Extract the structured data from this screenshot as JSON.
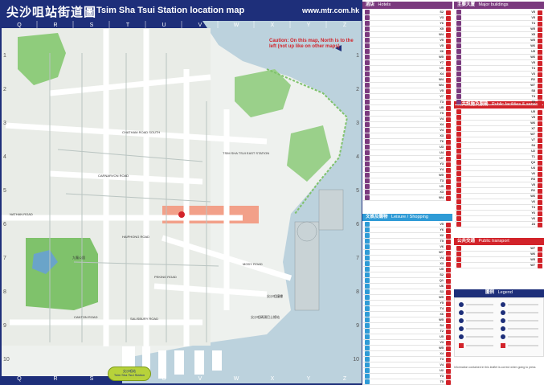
{
  "header": {
    "title_zh": "尖沙咀站街道圖",
    "title_en": "Tsim Sha Tsui Station location map",
    "url": "www.mtr.com.hk"
  },
  "map": {
    "grid_columns": [
      "Q",
      "R",
      "S",
      "T",
      "U",
      "V",
      "W",
      "X",
      "Y",
      "Z"
    ],
    "grid_rows": [
      "1",
      "2",
      "3",
      "4",
      "5",
      "6",
      "7",
      "8",
      "9",
      "10"
    ],
    "caution": "Caution: On this map, North is to the left (not up like on other maps)",
    "colors": {
      "water": "#bcd2dd",
      "land": "#eef1ee",
      "park": "#7fc26b",
      "station": "#f2a089",
      "road": "#ffffff"
    },
    "labels": {
      "chatham_road": "CHATHAM ROAD SOUTH",
      "nathan_road": "NATHAN ROAD",
      "salisbury_road": "SALISBURY ROAD",
      "canton_road": "CANTON ROAD",
      "peking_road": "PEKING ROAD",
      "haiphong_road": "HAIPHONG ROAD",
      "carnarvon_road": "CARNARVON ROAD",
      "mody_road": "MODY ROAD",
      "kowloon_park": "九龍公園",
      "tst_east_station": "TSIM SHA TSUI EAST STATION",
      "station_zh": "尖沙咀站",
      "station_en": "Tsim Sha Tsui Station",
      "clock_tower": "尖沙咀鐘樓",
      "tst_bus_terminus": "尖沙咀碼頭巴士總站"
    }
  },
  "panel": {
    "hotels": {
      "zh": "酒店",
      "en": "Hotels"
    },
    "major": {
      "zh": "主要大廈",
      "en": "Major buildings"
    },
    "leisure": {
      "zh": "文娛及購物",
      "en": "Leisure / Shopping"
    },
    "public": {
      "zh": "公共設施及服務",
      "en": "Public facilities & services"
    },
    "transport": {
      "zh": "公共交通",
      "en": "Public transport"
    },
    "legend": {
      "zh": "圖例",
      "en": "Legend"
    },
    "hotel_codes": [
      "S2",
      "V3",
      "Y6",
      "X5",
      "W4",
      "V5",
      "V5",
      "X6",
      "W5",
      "Y7",
      "U5",
      "X4",
      "W4",
      "W4",
      "V5",
      "V7",
      "T3",
      "U5",
      "T5",
      "V4",
      "X4",
      "V4",
      "X3",
      "T6",
      "U3",
      "U4",
      "U7",
      "Y3",
      "Y4",
      "W5",
      "T3",
      "U5",
      "X3",
      "W4"
    ],
    "major_codes": [
      "V5",
      "V5",
      "T4",
      "W5",
      "X5",
      "W5",
      "W6",
      "U5",
      "W6",
      "V5",
      "T4",
      "V3",
      "R2",
      "W7",
      "S8",
      "T4",
      "T5"
    ],
    "public_codes": [
      "U5",
      "V5",
      "W6",
      "X7",
      "W7",
      "V7",
      "S4",
      "U2",
      "T1",
      "Q4",
      "U4",
      "V6",
      "R3",
      "V5",
      "R2",
      "W6",
      "V6",
      "T4",
      "Y6",
      "V6",
      "Z4"
    ],
    "leisure_codes": [
      "V5",
      "Y6",
      "X2",
      "T5",
      "V6",
      "W7",
      "V4",
      "X3",
      "U5",
      "S2",
      "Q1",
      "U6",
      "S3",
      "W5",
      "Y5",
      "T4",
      "X6",
      "W5",
      "S4",
      "T2",
      "U5",
      "V3",
      "W5",
      "X4",
      "T3",
      "V4",
      "U2",
      "Y3",
      "T5"
    ],
    "transport_codes": [
      "W7",
      "W6",
      "W5",
      "W7"
    ],
    "footer": "Information contained in this leaflet is correct when going to press"
  }
}
